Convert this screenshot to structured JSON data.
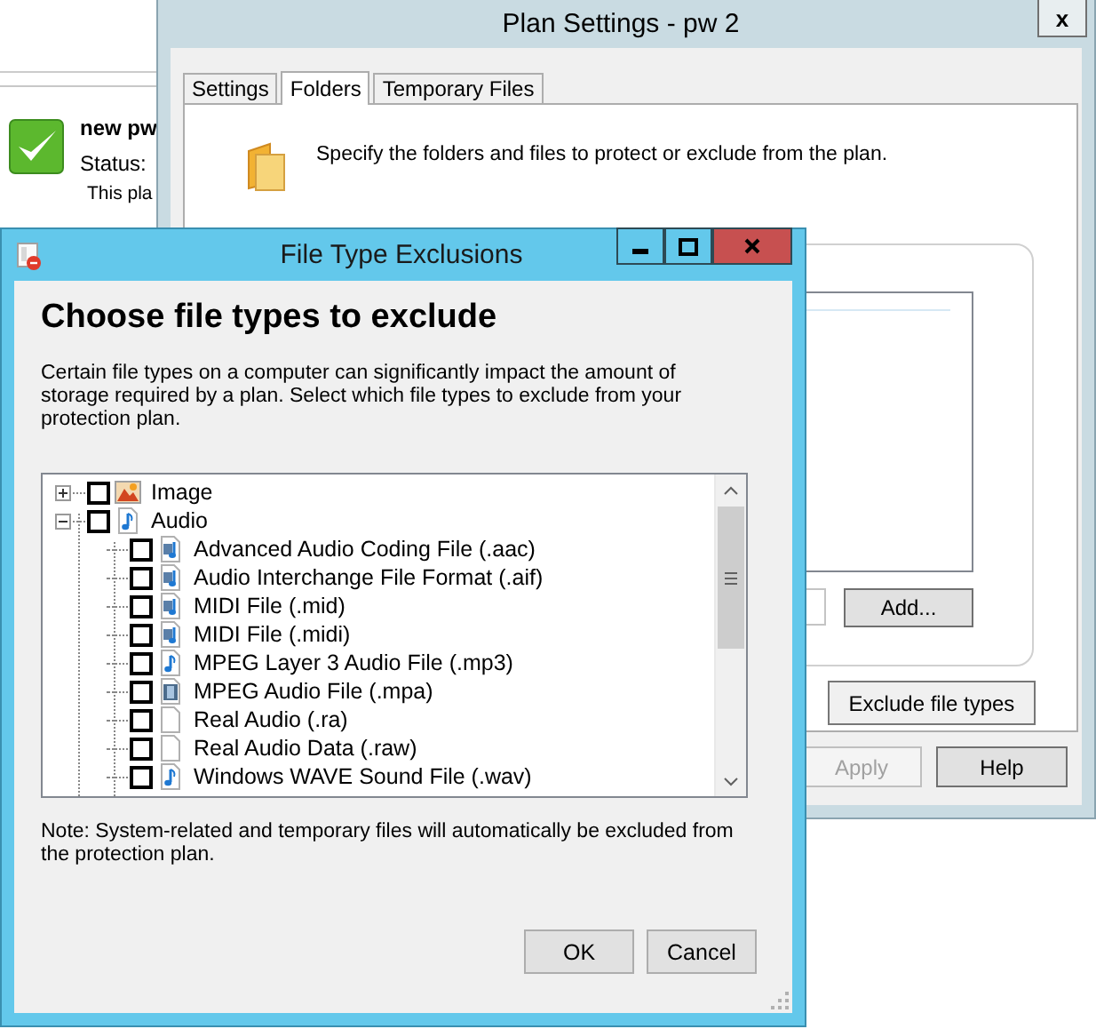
{
  "background_app": {
    "plan_name": "new pw",
    "status_label": "Status:",
    "description": "This pla"
  },
  "plan_settings": {
    "title": "Plan Settings - pw 2",
    "close": "x",
    "tabs": [
      {
        "label": "Settings",
        "selected": false
      },
      {
        "label": "Folders",
        "selected": true
      },
      {
        "label": "Temporary Files",
        "selected": false
      }
    ],
    "description": "Specify the folders and files to protect or exclude from the plan.",
    "buttons": {
      "add": "Add...",
      "exclude": "Exclude file types"
    },
    "footer_buttons": [
      {
        "label": "Apply",
        "disabled": true
      },
      {
        "label": "Help",
        "disabled": false
      }
    ]
  },
  "file_type_exclusions": {
    "title": "File Type Exclusions",
    "heading": "Choose file types to exclude",
    "description": "Certain file types on a computer can significantly impact the amount of storage required by a plan. Select which file types to exclude from your protection plan.",
    "tree": [
      {
        "label": "Image",
        "kind": "image",
        "checked": false,
        "expanded": false
      },
      {
        "label": "Audio",
        "kind": "audio",
        "checked": false,
        "expanded": true,
        "children": [
          {
            "label": "Advanced Audio Coding File (.aac)",
            "kind": "media",
            "checked": false
          },
          {
            "label": "Audio Interchange File Format (.aif)",
            "kind": "media",
            "checked": false
          },
          {
            "label": "MIDI File (.mid)",
            "kind": "media",
            "checked": false
          },
          {
            "label": "MIDI File (.midi)",
            "kind": "media",
            "checked": false
          },
          {
            "label": "MPEG Layer 3 Audio File (.mp3)",
            "kind": "audio",
            "checked": false
          },
          {
            "label": "MPEG Audio File (.mpa)",
            "kind": "video",
            "checked": false
          },
          {
            "label": "Real Audio (.ra)",
            "kind": "blank",
            "checked": false
          },
          {
            "label": "Real Audio Data (.raw)",
            "kind": "blank",
            "checked": false
          },
          {
            "label": "Windows WAVE Sound File (.wav)",
            "kind": "audio",
            "checked": false
          }
        ]
      }
    ],
    "note": "Note: System-related and temporary files will automatically be excluded from the protection plan.",
    "buttons": [
      {
        "label": "OK"
      },
      {
        "label": "Cancel"
      }
    ]
  }
}
